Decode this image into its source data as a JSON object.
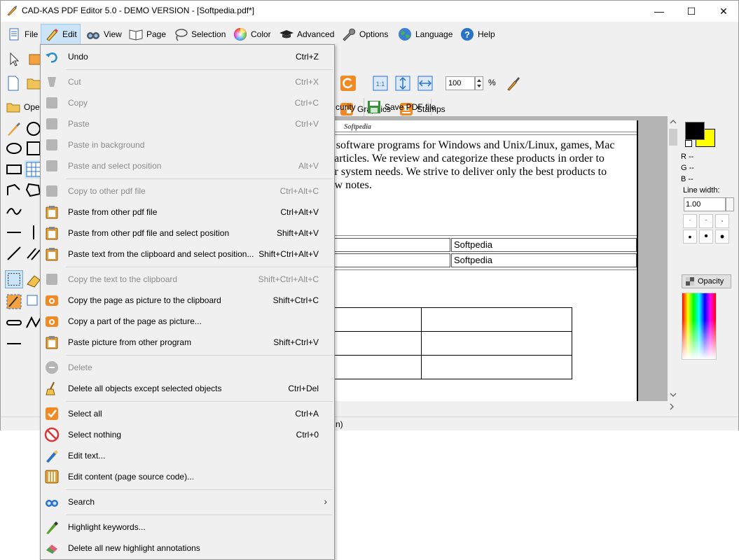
{
  "window": {
    "title": "CAD-KAS PDF Editor 5.0 - DEMO VERSION - [Softpedia.pdf*]",
    "minimize": "—",
    "maximize": "☐",
    "close": "✕"
  },
  "menubar": {
    "items": [
      {
        "label": "File",
        "icon": "file-icon"
      },
      {
        "label": "Edit",
        "icon": "pencil-icon"
      },
      {
        "label": "View",
        "icon": "binoculars-icon"
      },
      {
        "label": "Page",
        "icon": "book-icon"
      },
      {
        "label": "Selection",
        "icon": "lasso-icon"
      },
      {
        "label": "Color",
        "icon": "color-wheel-icon"
      },
      {
        "label": "Advanced",
        "icon": "graduation-cap-icon"
      },
      {
        "label": "Options",
        "icon": "wrench-icon"
      },
      {
        "label": "Language",
        "icon": "globe-icon"
      },
      {
        "label": "Help",
        "icon": "help-icon"
      }
    ]
  },
  "toolbar": {
    "graphics_label": "Graphics",
    "stamps_label": "Stamps",
    "zoom_value": "100",
    "zoom_unit": "%",
    "open_label": "Ope",
    "security_label": "curity",
    "save_pdf_label": "Save PDF file"
  },
  "document": {
    "header": "Softpedia",
    "lines": [
      "try software programs for Windows and Unix/Linux, games, Mac",
      "ed articles. We review and categorize these products in order to",
      "heir system needs. We strive to deliver only the best products to",
      "view notes."
    ],
    "cell1": "Softpedia",
    "cell2": "Softpedia"
  },
  "right_panel": {
    "r_label": "R --",
    "g_label": "G --",
    "b_label": "B --",
    "line_width_label": "Line width:",
    "line_width_value": "1.00",
    "opacity_label": "Opacity",
    "fg_color": "#000000",
    "bg_color": "#ffff00"
  },
  "status": {
    "text": "n)"
  },
  "edit_menu": {
    "items": [
      {
        "label": "Undo",
        "shortcut": "Ctrl+Z",
        "enabled": true,
        "icon": "undo-icon"
      },
      {
        "label": "Cut",
        "shortcut": "Ctrl+X",
        "enabled": false,
        "icon": "cut-icon"
      },
      {
        "label": "Copy",
        "shortcut": "Ctrl+C",
        "enabled": false,
        "icon": "copy-icon"
      },
      {
        "label": "Paste",
        "shortcut": "Ctrl+V",
        "enabled": false,
        "icon": "paste-icon"
      },
      {
        "label": "Paste in background",
        "shortcut": "",
        "enabled": false,
        "icon": "paste-background-icon"
      },
      {
        "label": "Paste and select position",
        "shortcut": "Alt+V",
        "enabled": false,
        "icon": "paste-position-icon"
      },
      {
        "label": "Copy to other pdf file",
        "shortcut": "Ctrl+Alt+C",
        "enabled": false,
        "icon": "copy-pdf-icon"
      },
      {
        "label": "Paste from other pdf file",
        "shortcut": "Ctrl+Alt+V",
        "enabled": true,
        "icon": "clipboard-icon"
      },
      {
        "label": "Paste from other pdf file and select position",
        "shortcut": "Shift+Alt+V",
        "enabled": true,
        "icon": "clipboard-icon"
      },
      {
        "label": "Paste text from the clipboard and select position...",
        "shortcut": "Shift+Ctrl+Alt+V",
        "enabled": true,
        "icon": "clipboard-icon"
      },
      {
        "label": "Copy the text to the clipboard",
        "shortcut": "Shift+Ctrl+Alt+C",
        "enabled": false,
        "icon": "copy-text-icon"
      },
      {
        "label": "Copy the page as picture to the clipboard",
        "shortcut": "Shift+Ctrl+C",
        "enabled": true,
        "icon": "camera-icon"
      },
      {
        "label": "Copy a part of the page as picture...",
        "shortcut": "",
        "enabled": true,
        "icon": "camera-icon"
      },
      {
        "label": "Paste picture from other program",
        "shortcut": "Shift+Ctrl+V",
        "enabled": true,
        "icon": "clipboard-icon"
      },
      {
        "label": "Delete",
        "shortcut": "",
        "enabled": false,
        "icon": "delete-icon"
      },
      {
        "label": "Delete all objects except selected objects",
        "shortcut": "Ctrl+Del",
        "enabled": true,
        "icon": "broom-icon"
      },
      {
        "label": "Select all",
        "shortcut": "Ctrl+A",
        "enabled": true,
        "icon": "checkmark-icon"
      },
      {
        "label": "Select nothing",
        "shortcut": "Ctrl+0",
        "enabled": true,
        "icon": "no-entry-icon"
      },
      {
        "label": "Edit text...",
        "shortcut": "",
        "enabled": true,
        "icon": "pen-icon"
      },
      {
        "label": "Edit content (page source code)...",
        "shortcut": "",
        "enabled": true,
        "icon": "source-code-icon"
      },
      {
        "label": "Search",
        "shortcut": "",
        "enabled": true,
        "icon": "binoculars-icon",
        "submenu": true
      },
      {
        "label": "Highlight keywords...",
        "shortcut": "",
        "enabled": true,
        "icon": "highlighter-icon"
      },
      {
        "label": "Delete all new highlight annotations",
        "shortcut": "",
        "enabled": true,
        "icon": "eraser-icon"
      }
    ],
    "submenu_arrow": "›"
  }
}
